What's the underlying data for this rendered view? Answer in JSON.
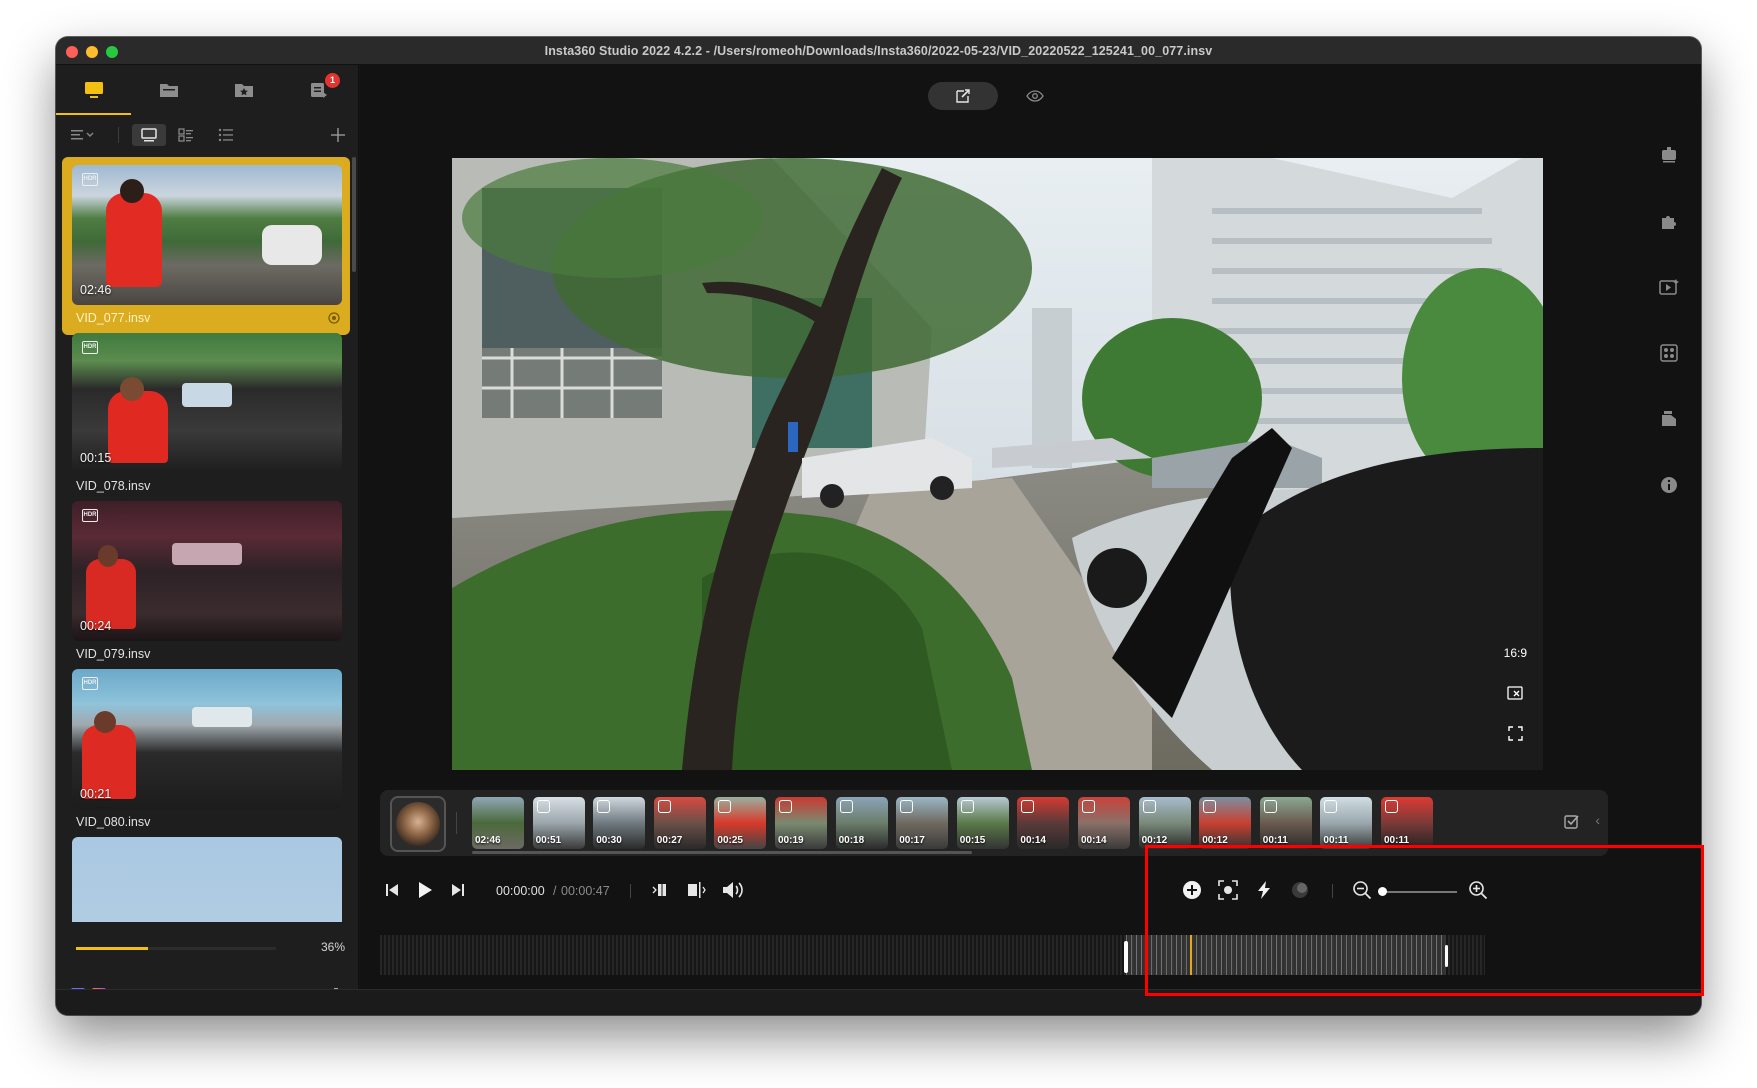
{
  "window": {
    "title": "Insta360 Studio 2022 4.2.2 - /Users/romeoh/Downloads/Insta360/2022-05-23/VID_20220522_125241_00_077.insv"
  },
  "sidebar": {
    "tabs": [
      {
        "icon": "monitor-icon",
        "active": true
      },
      {
        "icon": "folder-icon",
        "active": false
      },
      {
        "icon": "star-folder-icon",
        "active": false
      },
      {
        "icon": "export-queue-icon",
        "active": false,
        "badge": "1"
      }
    ],
    "files": [
      {
        "name": "VID_077.insv",
        "duration": "02:46",
        "active": true
      },
      {
        "name": "VID_078.insv",
        "duration": "00:15",
        "active": false
      },
      {
        "name": "VID_079.insv",
        "duration": "00:24",
        "active": false
      },
      {
        "name": "VID_080.insv",
        "duration": "00:21",
        "active": false
      }
    ],
    "progress": {
      "percent_label": "36%",
      "value": 36
    }
  },
  "preview": {
    "aspect_label": "16:9"
  },
  "clips": {
    "durations": [
      "02:46",
      "00:51",
      "00:30",
      "00:27",
      "00:25",
      "00:19",
      "00:18",
      "00:17",
      "00:15",
      "00:14",
      "00:14",
      "00:12",
      "00:12",
      "00:11",
      "00:11",
      "00:11"
    ]
  },
  "transport": {
    "current_time": "00:00:00",
    "separator": "/",
    "total_time": "00:00:47"
  },
  "colors": {
    "accent": "#f2c00f",
    "highlight": "#ff0000"
  }
}
